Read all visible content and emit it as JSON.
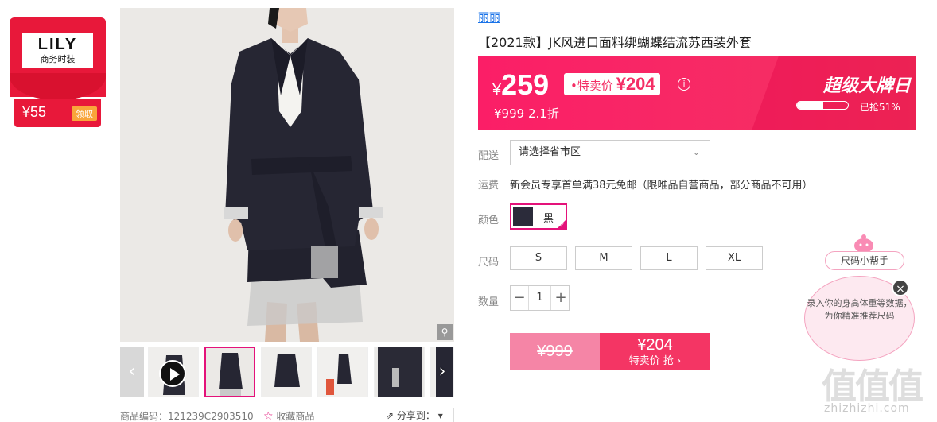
{
  "coupon": {
    "brand": "LILY",
    "subtitle": "商务时装",
    "amount": "¥55",
    "get_label": "领取"
  },
  "gallery": {
    "thumbnails": [
      {
        "kind": "video"
      },
      {
        "kind": "image",
        "active": true
      },
      {
        "kind": "image"
      },
      {
        "kind": "image"
      },
      {
        "kind": "image"
      },
      {
        "kind": "image"
      }
    ],
    "prev_label": "‹",
    "next_label": "›"
  },
  "footer": {
    "code": "商品编码：121239C2903510",
    "favorite": "收藏商品",
    "share": "分享到："
  },
  "product": {
    "brand_link": "丽丽",
    "title": "【2021款】JK风进口面料绑蝴蝶结流苏西装外套"
  },
  "price": {
    "currency": "¥",
    "current": "259",
    "special_label": "•特卖价",
    "special_value": "¥204",
    "original": "¥999",
    "discount": "2.1折",
    "promo_title": "超级大牌日",
    "sold_text": "已抢51%",
    "sold_fraction": 0.51,
    "info_icon": "ⓘ"
  },
  "delivery": {
    "label": "配送",
    "placeholder": "请选择省市区"
  },
  "shipping": {
    "label": "运费",
    "text": "新会员专享首单满38元免邮（限唯品自营商品，部分商品不可用）"
  },
  "color": {
    "label": "颜色",
    "options": [
      {
        "name": "黑",
        "selected": true
      }
    ]
  },
  "size": {
    "label": "尺码",
    "options": [
      "S",
      "M",
      "L",
      "XL"
    ]
  },
  "quantity": {
    "label": "数量",
    "value": "1",
    "minus": "−",
    "plus": "+"
  },
  "buy": {
    "original": "¥999",
    "price": "¥204",
    "action": "特卖价 抢 ›"
  },
  "size_helper": {
    "tag": "尺码小帮手",
    "bubble": "录入你的身高体重等数据，为你精准推荐尺码",
    "close": "×"
  },
  "watermark": {
    "logo": "值值值",
    "site": "zhizhizhi.com"
  },
  "colors": {
    "accent": "#e4127a",
    "price_bg": "#fb1e67",
    "coupon_red": "#e8183a",
    "link_blue": "#1a73e8"
  }
}
